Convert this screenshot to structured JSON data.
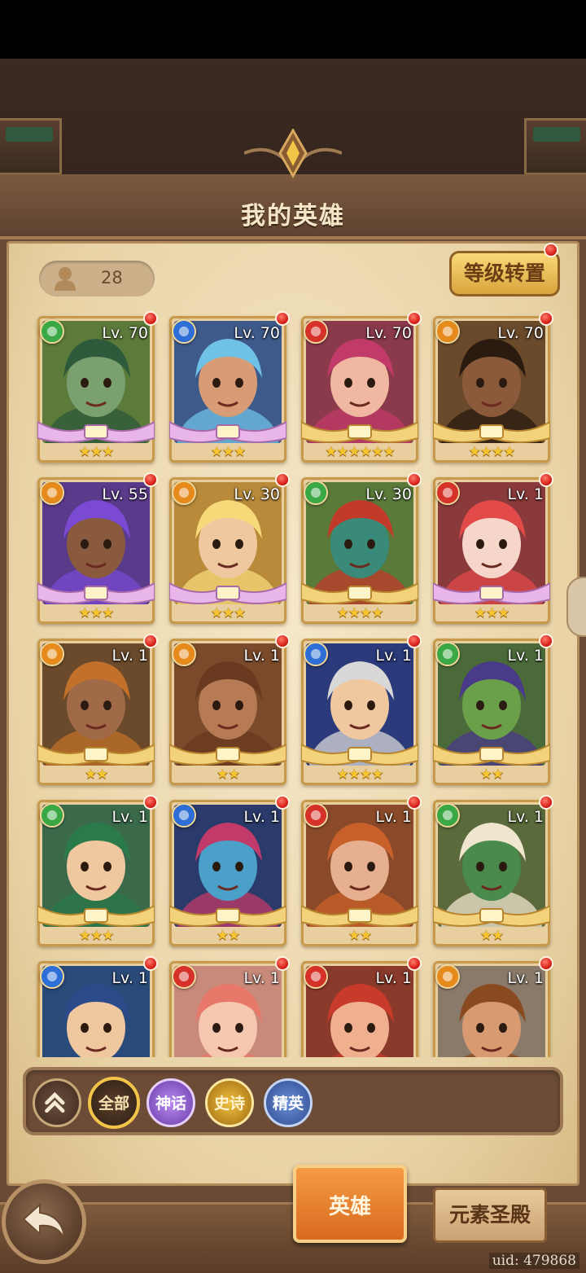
{
  "header": {
    "title": "我的英雄"
  },
  "hero_count": "28",
  "level_reset_label": "等级转置",
  "colors": {
    "nature": "#3aa845",
    "water": "#2d6fd6",
    "fire": "#d6322a",
    "light": "#e78a1c"
  },
  "heroes": [
    {
      "level": "Lv. 70",
      "element": "nature-icon",
      "stars": "★★★",
      "portrait_bg": "#5c7a3a",
      "skin": "#7aa070",
      "hair": "#2d5a3a",
      "frame": "pink"
    },
    {
      "level": "Lv. 70",
      "element": "water-icon",
      "stars": "★★★",
      "portrait_bg": "#3e5a8a",
      "skin": "#d79c76",
      "hair": "#6fc2e6",
      "frame": "pink"
    },
    {
      "level": "Lv. 70",
      "element": "fire-icon",
      "stars": "★★★★★★",
      "portrait_bg": "#8a3a4a",
      "skin": "#f0b8a0",
      "hair": "#c23a6a",
      "frame": "gold"
    },
    {
      "level": "Lv. 70",
      "element": "light-icon",
      "stars": "★★★★",
      "portrait_bg": "#6a4a2a",
      "skin": "#8a5a3a",
      "hair": "#2a1a10",
      "frame": "gold"
    },
    {
      "level": "Lv. 55",
      "element": "light-icon",
      "stars": "★★★",
      "portrait_bg": "#5a3a8a",
      "skin": "#8a5a3e",
      "hair": "#7a4ad2",
      "frame": "pink"
    },
    {
      "level": "Lv. 30",
      "element": "light-icon",
      "stars": "★★★",
      "portrait_bg": "#b88a3a",
      "skin": "#f0c8a0",
      "hair": "#f6da7a",
      "frame": "pink"
    },
    {
      "level": "Lv. 30",
      "element": "nature-icon",
      "stars": "★★★★",
      "portrait_bg": "#5a7a3a",
      "skin": "#3a8a7a",
      "hair": "#c23a2a",
      "frame": "gold"
    },
    {
      "level": "Lv. 1",
      "element": "fire-icon",
      "stars": "★★★",
      "portrait_bg": "#8a3a3a",
      "skin": "#f6d6c8",
      "hair": "#e24a4a",
      "frame": "pink"
    },
    {
      "level": "Lv. 1",
      "element": "light-icon",
      "stars": "★★",
      "portrait_bg": "#6a4a2a",
      "skin": "#a06a48",
      "hair": "#c2702a",
      "frame": "gold"
    },
    {
      "level": "Lv. 1",
      "element": "light-icon",
      "stars": "★★",
      "portrait_bg": "#7a4a2a",
      "skin": "#b67a54",
      "hair": "#6a3a20",
      "frame": "gold"
    },
    {
      "level": "Lv. 1",
      "element": "water-icon",
      "stars": "★★★★",
      "portrait_bg": "#2a3a7a",
      "skin": "#f0c8a0",
      "hair": "#d8d8d8",
      "frame": "gold"
    },
    {
      "level": "Lv. 1",
      "element": "nature-icon",
      "stars": "★★",
      "portrait_bg": "#4a6a3a",
      "skin": "#6aa04a",
      "hair": "#4a3a8a",
      "frame": "gold"
    },
    {
      "level": "Lv. 1",
      "element": "nature-icon",
      "stars": "★★★",
      "portrait_bg": "#3a6a4a",
      "skin": "#f0c8a0",
      "hair": "#2a7a4a",
      "frame": "gold"
    },
    {
      "level": "Lv. 1",
      "element": "water-icon",
      "stars": "★★",
      "portrait_bg": "#2a3a6a",
      "skin": "#4aa0c8",
      "hair": "#c23a6a",
      "frame": "gold"
    },
    {
      "level": "Lv. 1",
      "element": "fire-icon",
      "stars": "★★",
      "portrait_bg": "#8a4a2a",
      "skin": "#e6b090",
      "hair": "#c8602a",
      "frame": "gold"
    },
    {
      "level": "Lv. 1",
      "element": "nature-icon",
      "stars": "★★",
      "portrait_bg": "#5a6a3a",
      "skin": "#4a8a4a",
      "hair": "#f0e6d0",
      "frame": "gold"
    },
    {
      "level": "Lv. 1",
      "element": "water-icon",
      "stars": "",
      "portrait_bg": "#2a4a7a",
      "skin": "#f0c8a0",
      "hair": "#2a4a8a",
      "frame": "gold"
    },
    {
      "level": "Lv. 1",
      "element": "fire-icon",
      "stars": "",
      "portrait_bg": "#c88a7a",
      "skin": "#f6c8b0",
      "hair": "#e8786a",
      "frame": "gold"
    },
    {
      "level": "Lv. 1",
      "element": "fire-icon",
      "stars": "",
      "portrait_bg": "#8a3a2a",
      "skin": "#f0b090",
      "hair": "#c83a2a",
      "frame": "gold"
    },
    {
      "level": "Lv. 1",
      "element": "light-icon",
      "stars": "",
      "portrait_bg": "#8a7a6a",
      "skin": "#d89a70",
      "hair": "#8a4a20",
      "frame": "gold"
    }
  ],
  "filters": {
    "all": "全部",
    "myth": "神话",
    "epic": "史诗",
    "elite": "精英"
  },
  "tabs": {
    "hero": "英雄",
    "temple": "元素圣殿"
  },
  "uid": "uid: 479868"
}
